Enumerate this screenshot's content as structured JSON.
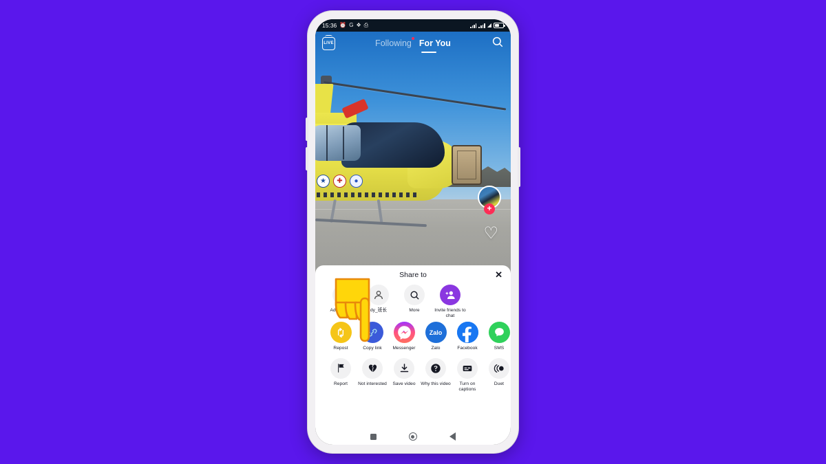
{
  "background_color": "#5A17EC",
  "status_bar": {
    "time": "15:36",
    "left_icons": [
      "alarm-icon",
      "google-icon",
      "app-icon",
      "printer-icon"
    ],
    "right_icons": [
      "signal-bars-1",
      "signal-bars-2",
      "wifi-icon",
      "battery-icon"
    ]
  },
  "top_nav": {
    "live_label": "LIVE",
    "tabs": [
      {
        "label": "Following",
        "active": false,
        "has_badge": true
      },
      {
        "label": "For You",
        "active": true,
        "has_badge": false
      }
    ],
    "search_icon": "search-icon"
  },
  "video": {
    "description": "yellow medical rescue helicopter parked on a helipad under a blue sky",
    "avatar_icon": "avatar",
    "follow_label": "+",
    "like_icon": "heart-icon"
  },
  "share_sheet": {
    "title": "Share to",
    "close_label": "✕",
    "rows": {
      "apps": [
        {
          "label": "Add to Story",
          "icon": "story-icon",
          "style": "gray-circle"
        },
        {
          "label": "dy_班长",
          "icon": "contact-avatar",
          "style": "gray-circle"
        },
        {
          "label": "More",
          "icon": "search-icon",
          "style": "gray-circle"
        },
        {
          "label": "Invite friends to chat",
          "icon": "add-person-icon",
          "style": "purple-circle"
        }
      ],
      "social": [
        {
          "label": "Repost",
          "icon": "repost-icon",
          "color": "#f5c518"
        },
        {
          "label": "Copy link",
          "icon": "link-icon",
          "color": "#3b5ad9"
        },
        {
          "label": "Messenger",
          "icon": "messenger-icon",
          "color": "#ffffff"
        },
        {
          "label": "Zalo",
          "icon": "zalo-icon",
          "color": "#1e6fd9"
        },
        {
          "label": "Facebook",
          "icon": "facebook-icon",
          "color": "#1877f2"
        },
        {
          "label": "SMS",
          "icon": "sms-icon",
          "color": "#2fd15b"
        }
      ],
      "actions": [
        {
          "label": "Report",
          "icon": "flag-icon"
        },
        {
          "label": "Not interested",
          "icon": "broken-heart-icon"
        },
        {
          "label": "Save video",
          "icon": "download-icon"
        },
        {
          "label": "Why this video",
          "icon": "question-icon"
        },
        {
          "label": "Turn on captions",
          "icon": "captions-icon"
        },
        {
          "label": "Duet",
          "icon": "duet-icon"
        }
      ]
    }
  },
  "android_nav": {
    "recents": "square-recents-icon",
    "home": "circle-home-icon",
    "back": "triangle-back-icon"
  },
  "cursor": {
    "icon": "pointing-hand-cursor"
  }
}
